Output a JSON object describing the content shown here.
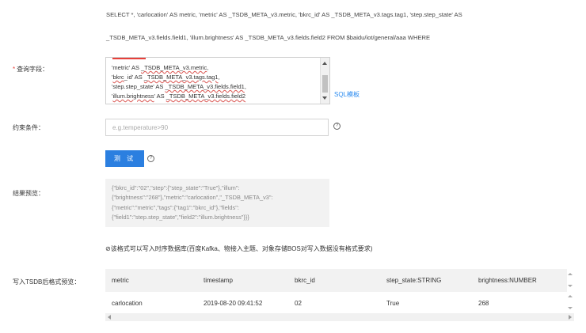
{
  "sql_preview": {
    "line1": "SELECT *, 'carlocation' AS metric, 'metric' AS _TSDB_META_v3.metric, 'bkrc_id' AS _TSDB_META_v3.tags.tag1, 'step.step_state' AS",
    "line2": "_TSDB_META_v3.fields.field1, 'illum.brightness' AS _TSDB_META_v3.fields.field2 FROM $baidu/iot/general/aaa WHERE"
  },
  "query_field": {
    "required_mark": "*",
    "label": "查询字段：",
    "lines": [
      {
        "pre": "'metric' AS ",
        "u1": "_TSDB_META_v3.metric",
        "post": ","
      },
      {
        "pre": "'",
        "u1": "bkrc",
        "mid": "_id' AS ",
        "u2": "_TSDB_META_v3.tags.tag1",
        "post": ","
      },
      {
        "pre": "'step.step_state' AS ",
        "u1": "_TSDB_META_v3.fields.field1",
        "post": ","
      },
      {
        "pre": "'",
        "u1": "illum.brightness",
        "mid": "' AS ",
        "u2": "_TSDB_META_v3.fields.field2",
        "post": ""
      }
    ],
    "sql_template_link": "SQL模板"
  },
  "constraint": {
    "label": "约束条件：",
    "placeholder": "e.g.temperature>90",
    "help": "?"
  },
  "test_button": {
    "label": "测 试",
    "help": "?"
  },
  "result_preview": {
    "label": "结果预览：",
    "lines": [
      "{\"bkrc_id\":\"02\",\"step\":{\"step_state\":\"True\"},\"illum\":",
      "{\"brightness\":\"268\"},\"metric\":\"carlocation\",\"_TSDB_META_v3\":",
      "{\"metric\":\"metric\",\"tags\":{\"tag1\":\"bkrc_id\"},\"fields\":",
      "{\"field1\":\"step.step_state\",\"field2\":\"illum.brightness\"}}}"
    ]
  },
  "format_note": "⊘该格式可以写入时序数据库(百度Kafka、物接入主题、对象存储BOS对写入数据没有格式要求)",
  "tsdb_preview": {
    "label": "写入TSDB后格式预览：",
    "columns": [
      "metric",
      "timestamp",
      "bkrc_id",
      "step_state:STRING",
      "brightness:NUMBER"
    ],
    "rows": [
      [
        "carlocation",
        "2019-08-20 09:41:52",
        "02",
        "True",
        "268"
      ]
    ]
  }
}
